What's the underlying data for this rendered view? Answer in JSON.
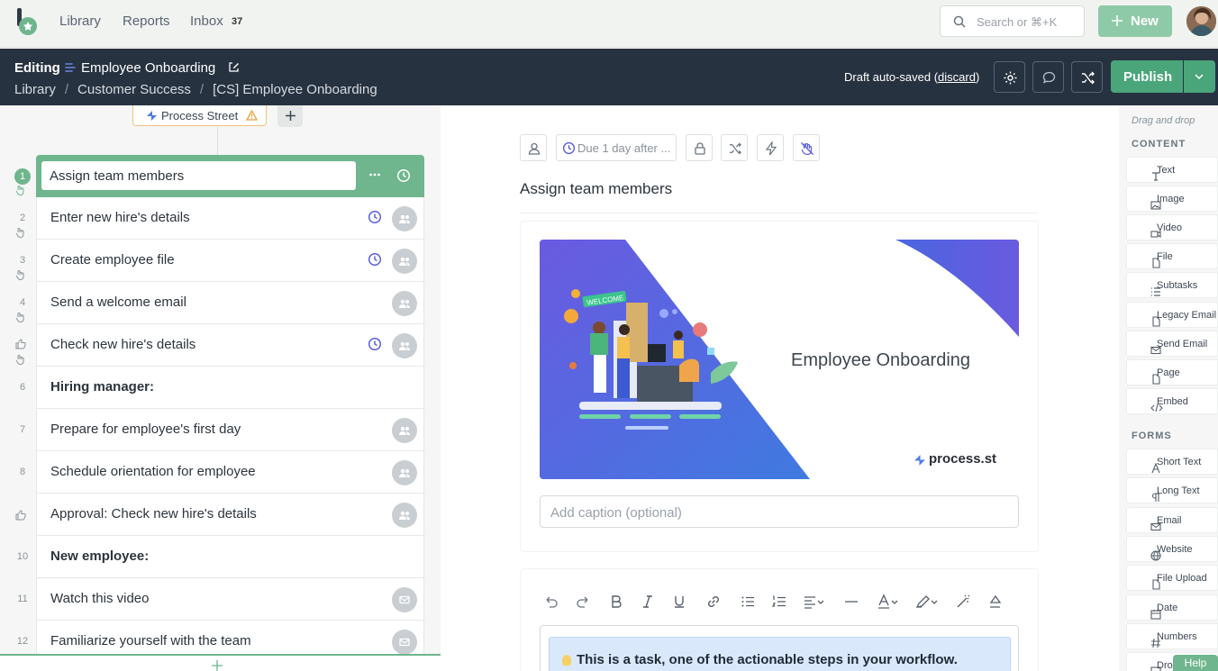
{
  "nav": {
    "library": "Library",
    "reports": "Reports",
    "inbox": "Inbox",
    "inbox_count": "37",
    "search_placeholder": "Search or ⌘+K",
    "new_label": "New"
  },
  "editor": {
    "editing_label": "Editing",
    "workflow_title": "Employee Onboarding",
    "breadcrumbs": [
      "Library",
      "Customer Success",
      "[CS] Employee Onboarding"
    ],
    "draft_prefix": "Draft auto-saved (",
    "discard": "discard",
    "draft_suffix": ")",
    "publish_label": "Publish"
  },
  "brand": {
    "label": "Process Street"
  },
  "tasks": [
    {
      "num": "1",
      "name": "Assign team members"
    },
    {
      "num": "2",
      "name": "Enter new hire's details"
    },
    {
      "num": "3",
      "name": "Create employee file"
    },
    {
      "num": "4",
      "name": "Send a welcome email"
    },
    {
      "num": "",
      "name": "Check new hire's details"
    },
    {
      "num": "6",
      "name": "Hiring manager:"
    },
    {
      "num": "7",
      "name": "Prepare for employee's first day"
    },
    {
      "num": "8",
      "name": "Schedule orientation for employee"
    },
    {
      "num": "",
      "name": "Approval: Check new hire's details"
    },
    {
      "num": "10",
      "name": "New employee:"
    },
    {
      "num": "11",
      "name": "Watch this video"
    },
    {
      "num": "12",
      "name": "Familiarize yourself with the team"
    }
  ],
  "task_panel": {
    "due_label": "Due 1 day after ...",
    "title": "Assign team members",
    "banner_title": "Employee Onboarding",
    "banner_brand": "process.st",
    "caption_placeholder": "Add caption (optional)",
    "callout_text": "This is a task, one of the actionable steps in your workflow."
  },
  "palette": {
    "hint": "Drag and drop",
    "content_header": "CONTENT",
    "content": [
      "Text",
      "Image",
      "Video",
      "File",
      "Subtasks",
      "Legacy Email",
      "Send Email",
      "Page",
      "Embed"
    ],
    "forms_header": "FORMS",
    "forms": [
      "Short Text",
      "Long Text",
      "Email",
      "Website",
      "File Upload",
      "Date",
      "Numbers",
      "Dro"
    ]
  },
  "help_label": "Help",
  "colors": {
    "brand_green": "#6fb58d",
    "publish_green": "#4aa57a",
    "dark_bar": "#273240"
  }
}
